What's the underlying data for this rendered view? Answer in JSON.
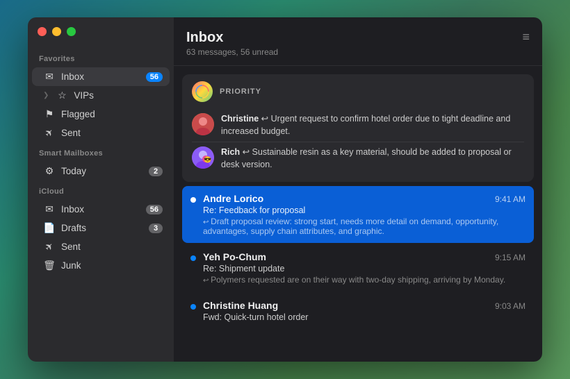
{
  "window": {
    "controls": {
      "close": "close",
      "minimize": "minimize",
      "maximize": "maximize"
    }
  },
  "sidebar": {
    "favorites_label": "Favorites",
    "smart_mailboxes_label": "Smart Mailboxes",
    "icloud_label": "iCloud",
    "items": {
      "favorites": [
        {
          "id": "inbox",
          "label": "Inbox",
          "icon": "✉",
          "badge": "56",
          "active": true
        },
        {
          "id": "vips",
          "label": "VIPs",
          "icon": "☆",
          "badge": "",
          "chevron": "❯"
        },
        {
          "id": "flagged",
          "label": "Flagged",
          "icon": "⚑",
          "badge": ""
        },
        {
          "id": "sent",
          "label": "Sent",
          "icon": "✈",
          "badge": ""
        }
      ],
      "smart": [
        {
          "id": "today",
          "label": "Today",
          "icon": "⚙",
          "badge": "2"
        }
      ],
      "icloud": [
        {
          "id": "icloud-inbox",
          "label": "Inbox",
          "icon": "✉",
          "badge": "56"
        },
        {
          "id": "drafts",
          "label": "Drafts",
          "icon": "📄",
          "badge": "3"
        },
        {
          "id": "icloud-sent",
          "label": "Sent",
          "icon": "✈",
          "badge": ""
        },
        {
          "id": "junk",
          "label": "Junk",
          "icon": "🗑",
          "badge": ""
        }
      ]
    }
  },
  "main": {
    "header": {
      "title": "Inbox",
      "subtitle": "63 messages, 56 unread",
      "filter_icon": "≡"
    },
    "priority": {
      "label": "PRIORITY",
      "messages": [
        {
          "id": "pm1",
          "sender": "Christine",
          "preview": "Urgent request to confirm hotel order due to tight deadline and increased budget."
        },
        {
          "id": "pm2",
          "sender": "Rich",
          "preview": "Sustainable resin as a key material, should be added to proposal or desk version."
        }
      ]
    },
    "messages": [
      {
        "id": "msg1",
        "sender": "Andre Lorico",
        "time": "9:41 AM",
        "subject": "Re: Feedback for proposal",
        "preview": "Draft proposal review: strong start, needs more detail on demand, opportunity, advantages, supply chain attributes, and graphic.",
        "unread": true,
        "selected": true
      },
      {
        "id": "msg2",
        "sender": "Yeh Po-Chum",
        "time": "9:15 AM",
        "subject": "Re: Shipment update",
        "preview": "Polymers requested are on their way with two-day shipping, arriving by Monday.",
        "unread": true,
        "selected": false
      },
      {
        "id": "msg3",
        "sender": "Christine Huang",
        "time": "9:03 AM",
        "subject": "Fwd: Quick-turn hotel order",
        "preview": "",
        "unread": true,
        "selected": false
      }
    ]
  }
}
